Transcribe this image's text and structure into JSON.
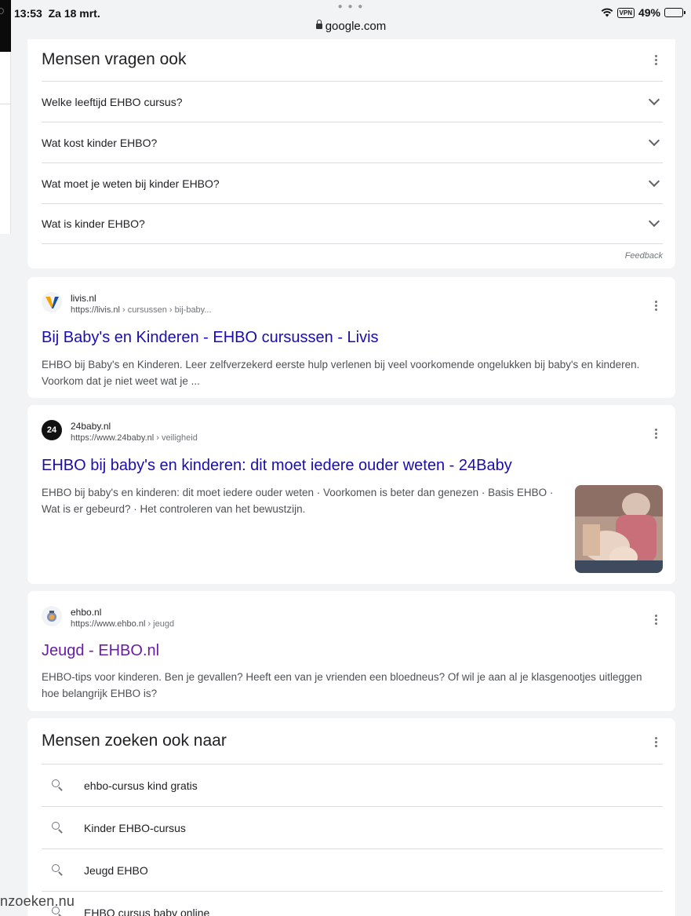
{
  "status_bar": {
    "time": "13:53",
    "date": "Za 18 mrt.",
    "url": "google.com",
    "vpn_label": "VPN",
    "battery": "49%",
    "battery_level": 0.49,
    "icons": [
      "wifi-icon",
      "vpn-icon",
      "battery-icon",
      "lock-icon"
    ]
  },
  "people_also_ask": {
    "title": "Mensen vragen ook",
    "questions": [
      "Welke leeftijd EHBO cursus?",
      "Wat kost kinder EHBO?",
      "Wat moet je weten bij kinder EHBO?",
      "Wat is kinder EHBO?"
    ],
    "feedback": "Feedback"
  },
  "results": [
    {
      "site": "livis.nl",
      "url_base": "https://livis.nl",
      "url_crumbs": " › cursussen › bij-baby...",
      "title": "Bij Baby's en Kinderen - EHBO cursussen - Livis",
      "snippet": "EHBO bij Baby's en Kinderen. Leer zelfverzekerd eerste hulp verlenen bij veel voorkomende ongelukken bij baby's en kinderen. Voorkom dat je niet weet wat je ...",
      "favicon": "livis-v-logo"
    },
    {
      "site": "24baby.nl",
      "url_base": "https://www.24baby.nl",
      "url_crumbs": " › veiligheid",
      "title": "EHBO bij baby's en kinderen: dit moet iedere ouder weten - 24Baby",
      "snippet": "EHBO bij baby's en kinderen: dit moet iedere ouder weten · Voorkomen is beter dan genezen · Basis EHBO · Wat is er gebeurd? · Het controleren van het bewustzijn.",
      "favicon": "24baby-logo",
      "favicon_text": "24"
    },
    {
      "site": "ehbo.nl",
      "url_base": "https://www.ehbo.nl",
      "url_crumbs": " › jeugd",
      "title": "Jeugd - EHBO.nl",
      "snippet": "EHBO-tips voor kinderen. Ben je gevallen? Heeft een van je vrienden een bloedneus? Of wil je aan al je klasgenootjes uitleggen hoe belangrijk EHBO is?",
      "favicon": "ehbo-logo"
    }
  ],
  "related_searches": {
    "title": "Mensen zoeken ook naar",
    "items": [
      "ehbo-cursus kind gratis",
      "Kinder EHBO-cursus",
      "Jeugd EHBO",
      "EHBO cursus baby online"
    ]
  },
  "watermark": "nzoeken.nu",
  "colors": {
    "link": "#1a0dab",
    "visited_link": "#681da8",
    "background": "#f1f3f4"
  }
}
